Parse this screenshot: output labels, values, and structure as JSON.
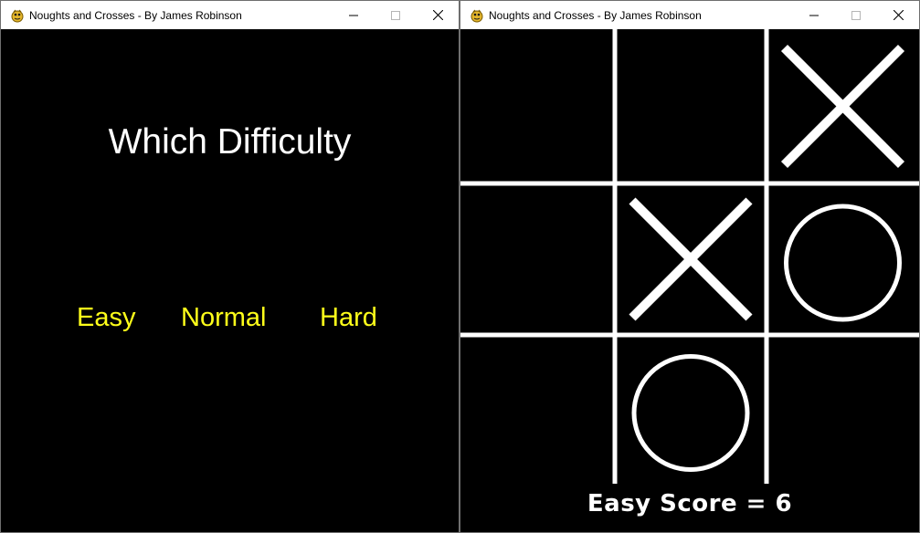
{
  "windows": [
    {
      "title": "Noughts and Crosses - By James Robinson",
      "icon": "python-snake-icon",
      "controls": [
        "minimize",
        "maximize",
        "close"
      ]
    },
    {
      "title": "Noughts and Crosses - By James Robinson",
      "icon": "python-snake-icon",
      "controls": [
        "minimize",
        "maximize",
        "close"
      ]
    }
  ],
  "menu": {
    "heading": "Which Difficulty",
    "options": [
      "Easy",
      "Normal",
      "Hard"
    ],
    "option_color": "#ffff1a",
    "heading_color": "#ffffff",
    "background": "#000000"
  },
  "game": {
    "board": [
      [
        "",
        "",
        "X"
      ],
      [
        "",
        "X",
        "O"
      ],
      [
        "",
        "O",
        ""
      ]
    ],
    "score_text": "Easy Score = 6",
    "line_color": "#ffffff",
    "background": "#000000"
  }
}
